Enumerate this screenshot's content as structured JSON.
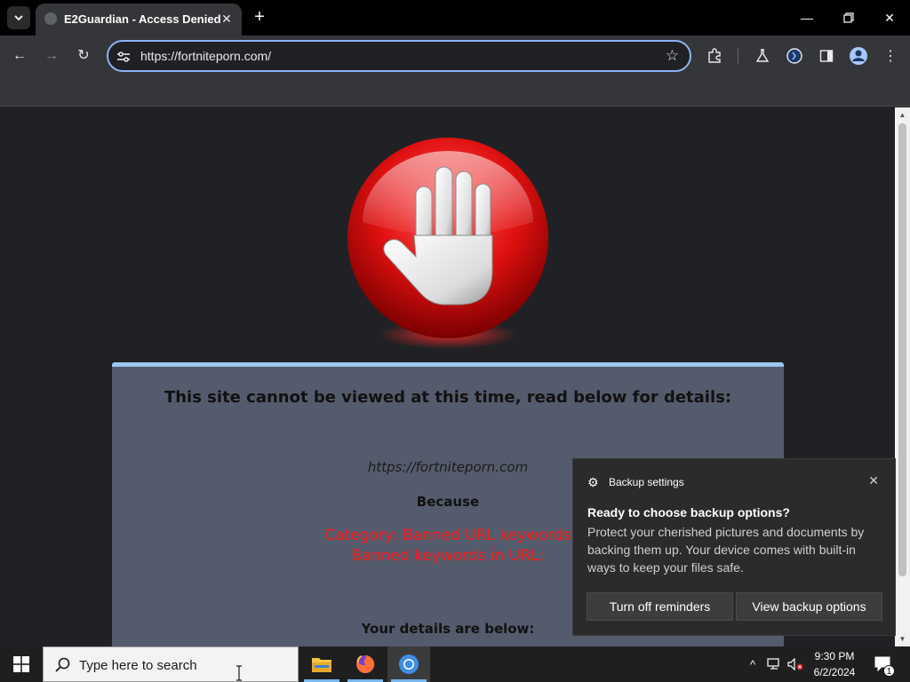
{
  "browser": {
    "tab_title": "E2Guardian - Access Denied",
    "url": "https://fortniteporn.com/"
  },
  "page": {
    "heading": "This site cannot be viewed at this time, read below for details:",
    "blocked_url": "https://fortniteporn.com",
    "because": "Because",
    "reason_lines": [
      "Category: Banned URL keywords",
      "Banned keywords in URL:"
    ],
    "details_heading": "Your details are below:"
  },
  "notification": {
    "app_name": "Backup settings",
    "title": "Ready to choose backup options?",
    "body": "Protect your cherished pictures and documents by backing them up. Your device comes with built-in ways to keep your files safe.",
    "buttons": [
      "Turn off reminders",
      "View backup options"
    ]
  },
  "taskbar": {
    "search_placeholder": "Type here to search",
    "time": "9:30 PM",
    "date": "6/2/2024",
    "notification_count": "1"
  },
  "colors": {
    "accent": "#8ab4f8",
    "panel": "#545b6c",
    "panel_border": "#9cc7ef",
    "reason_red": "#ff1a1a"
  },
  "icons": [
    "tab-search-icon",
    "favicon-icon",
    "close-icon",
    "plus-icon",
    "minimize-icon",
    "restore-icon",
    "back-icon",
    "forward-icon",
    "reload-icon",
    "site-settings-icon",
    "star-icon",
    "extensions-icon",
    "labs-icon",
    "sync-icon",
    "side-panel-icon",
    "profile-icon",
    "menu-icon",
    "stop-hand-icon",
    "gear-icon",
    "windows-start-icon",
    "search-icon",
    "file-explorer-icon",
    "firefox-icon",
    "chrome-icon",
    "chevron-up-icon",
    "network-icon",
    "volume-muted-icon",
    "action-center-icon"
  ]
}
